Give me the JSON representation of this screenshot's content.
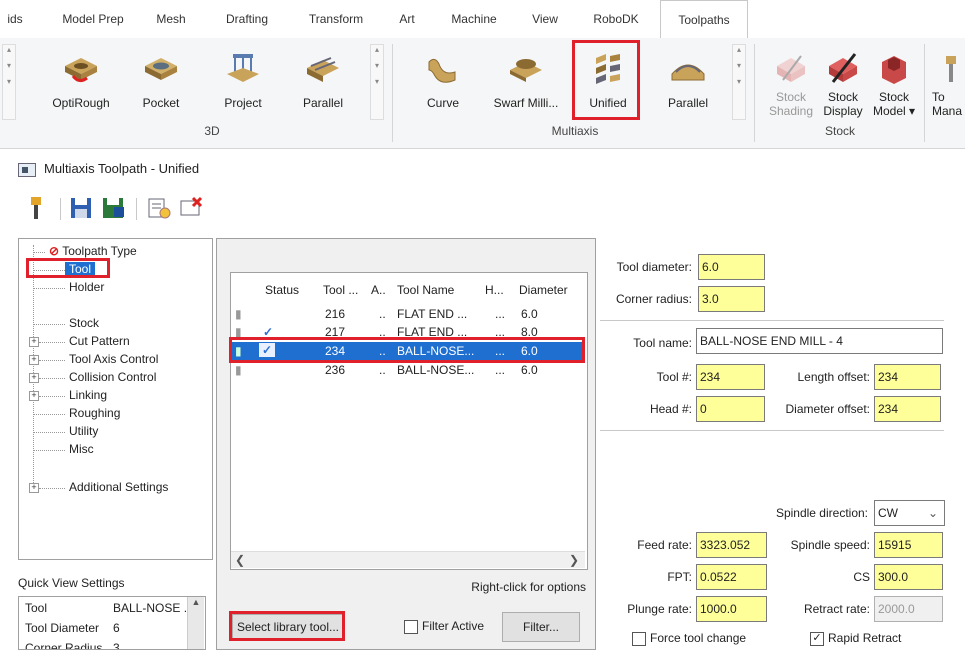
{
  "ribbon": {
    "tabs": [
      "ids",
      "Model Prep",
      "Mesh",
      "Drafting",
      "Transform",
      "Art",
      "Machine",
      "View",
      "RoboDK",
      "Toolpaths"
    ],
    "active_tab": "Toolpaths",
    "buttons_3d": [
      "OptiRough",
      "Pocket",
      "Project",
      "Parallel"
    ],
    "buttons_multiaxis": [
      "Curve",
      "Swarf Milli...",
      "Unified",
      "Parallel"
    ],
    "buttons_stock": [
      "Stock Shading",
      "Stock Display",
      "Stock Model"
    ],
    "stock_labels": {
      "shading_1": "Stock",
      "shading_2": "Shading",
      "display_1": "Stock",
      "display_2": "Display",
      "model_1": "Stock",
      "model_2": "Model ▾"
    },
    "tool_manager_1": "To",
    "tool_manager_2": "Mana",
    "groups": {
      "g3d": "3D",
      "multiaxis": "Multiaxis",
      "stock": "Stock"
    }
  },
  "window": {
    "title": "Multiaxis Toolpath - Unified"
  },
  "tree": {
    "items": [
      "Toolpath Type",
      "Tool",
      "Holder",
      "Stock",
      "Cut Pattern",
      "Tool Axis Control",
      "Collision Control",
      "Linking",
      "Roughing",
      "Utility",
      "Misc",
      "Additional Settings"
    ]
  },
  "quick_view": {
    "title": "Quick View Settings",
    "rows": [
      {
        "k": "Tool",
        "v": "BALL-NOSE ."
      },
      {
        "k": "Tool Diameter",
        "v": "6"
      },
      {
        "k": "Corner Radius",
        "v": "3"
      }
    ]
  },
  "tool_list": {
    "headers": [
      "Status",
      "Tool ...",
      "A..",
      "Tool Name",
      "H...",
      "Diameter"
    ],
    "rows": [
      {
        "status": "",
        "tool": "216",
        "a": "..",
        "name": "FLAT END ...",
        "h": "...",
        "diameter": "6.0"
      },
      {
        "status": "✓",
        "tool": "217",
        "a": "..",
        "name": "FLAT END ...",
        "h": "...",
        "diameter": "8.0"
      },
      {
        "status": "✓",
        "tool": "234",
        "a": "..",
        "name": "BALL-NOSE...",
        "h": "...",
        "diameter": "6.0"
      },
      {
        "status": "",
        "tool": "236",
        "a": "..",
        "name": "BALL-NOSE...",
        "h": "...",
        "diameter": "6.0"
      }
    ],
    "selected_index": 2,
    "hint": "Right-click for options"
  },
  "buttons": {
    "select_library": "Select library tool...",
    "filter_active": "Filter Active",
    "filter": "Filter..."
  },
  "params": {
    "tool_diameter_label": "Tool diameter:",
    "tool_diameter": "6.0",
    "corner_radius_label": "Corner radius:",
    "corner_radius": "3.0",
    "tool_name_label": "Tool name:",
    "tool_name": "BALL-NOSE END MILL - 4",
    "tool_num_label": "Tool #:",
    "tool_num": "234",
    "length_offset_label": "Length offset:",
    "length_offset": "234",
    "head_num_label": "Head #:",
    "head_num": "0",
    "diameter_offset_label": "Diameter offset:",
    "diameter_offset": "234",
    "spindle_direction_label": "Spindle direction:",
    "spindle_direction": "CW",
    "feed_rate_label": "Feed rate:",
    "feed_rate": "3323.052",
    "spindle_speed_label": "Spindle speed:",
    "spindle_speed": "15915",
    "fpt_label": "FPT:",
    "fpt": "0.0522",
    "cs_label": "CS",
    "cs": "300.0",
    "plunge_rate_label": "Plunge rate:",
    "plunge_rate": "1000.0",
    "retract_rate_label": "Retract rate:",
    "retract_rate": "2000.0",
    "force_tool_change": "Force tool change",
    "rapid_retract": "Rapid Retract"
  }
}
